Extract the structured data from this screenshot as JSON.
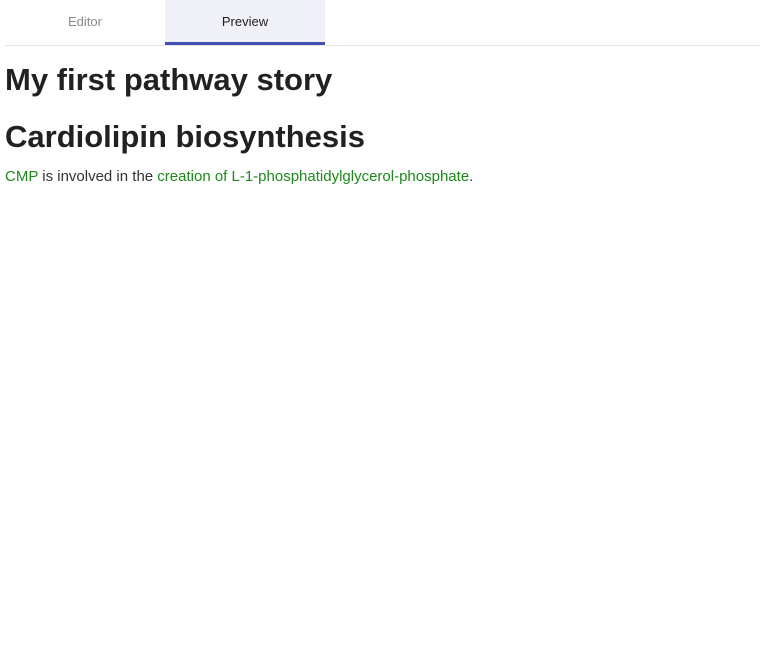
{
  "tabs": [
    {
      "label": "Editor",
      "active": false
    },
    {
      "label": "Preview",
      "active": true
    }
  ],
  "story": {
    "title": "My first pathway story",
    "section_title": "Cardiolipin biosynthesis",
    "sentence": {
      "entity": "CMP",
      "middle": " is involved in the ",
      "process": "creation of L-1-phosphatidylglycerol-phosphate",
      "end": "."
    }
  },
  "colors": {
    "accent": "#3f51b5",
    "link": "#1a8a1a",
    "active_tab_bg": "#f0f1f8"
  }
}
